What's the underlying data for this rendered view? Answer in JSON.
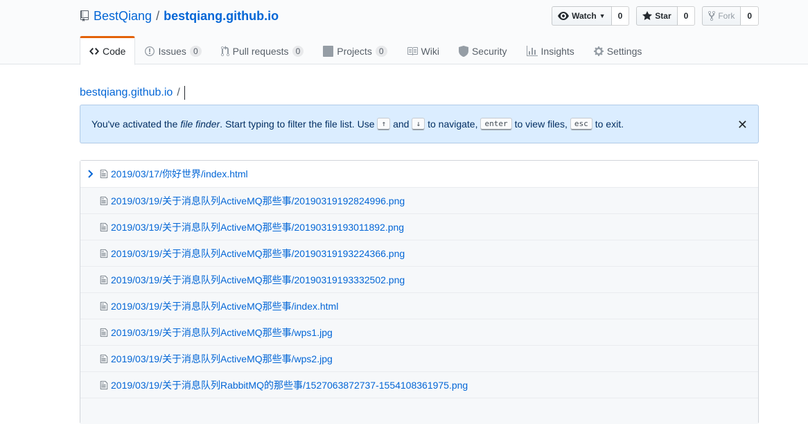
{
  "repo": {
    "owner": "BestQiang",
    "separator": "/",
    "name": "bestqiang.github.io"
  },
  "actions": {
    "watch": {
      "label": "Watch",
      "count": "0"
    },
    "star": {
      "label": "Star",
      "count": "0"
    },
    "fork": {
      "label": "Fork",
      "count": "0"
    }
  },
  "tabs": [
    {
      "label": "Code",
      "counter": null,
      "icon": "code-icon"
    },
    {
      "label": "Issues",
      "counter": "0",
      "icon": "issue-icon"
    },
    {
      "label": "Pull requests",
      "counter": "0",
      "icon": "pull-request-icon"
    },
    {
      "label": "Projects",
      "counter": "0",
      "icon": "project-icon"
    },
    {
      "label": "Wiki",
      "counter": null,
      "icon": "book-icon"
    },
    {
      "label": "Security",
      "counter": null,
      "icon": "shield-icon"
    },
    {
      "label": "Insights",
      "counter": null,
      "icon": "graph-icon"
    },
    {
      "label": "Settings",
      "counter": null,
      "icon": "gear-icon"
    }
  ],
  "breadcrumb": {
    "repo": "bestqiang.github.io",
    "slash": "/"
  },
  "flash": {
    "part1": "You've activated the",
    "em": "file finder",
    "part2": ". Start typing to filter the file list. Use",
    "key_up": "↑",
    "and": "and",
    "key_down": "↓",
    "part3": "to navigate,",
    "key_enter": "enter",
    "part4": "to view files,",
    "key_esc": "esc",
    "part5": "to exit.",
    "close": "✕"
  },
  "files": [
    "2019/03/17/你好世界/index.html",
    "2019/03/19/关于消息队列ActiveMQ那些事/20190319192824996.png",
    "2019/03/19/关于消息队列ActiveMQ那些事/20190319193011892.png",
    "2019/03/19/关于消息队列ActiveMQ那些事/20190319193224366.png",
    "2019/03/19/关于消息队列ActiveMQ那些事/20190319193332502.png",
    "2019/03/19/关于消息队列ActiveMQ那些事/index.html",
    "2019/03/19/关于消息队列ActiveMQ那些事/wps1.jpg",
    "2019/03/19/关于消息队列ActiveMQ那些事/wps2.jpg",
    "2019/03/19/关于消息队列RabbitMQ的那些事/1527063872737-1554108361975.png"
  ],
  "colors": {
    "link": "#0366d6",
    "accent": "#e36209",
    "flash_bg": "#dbedff"
  }
}
